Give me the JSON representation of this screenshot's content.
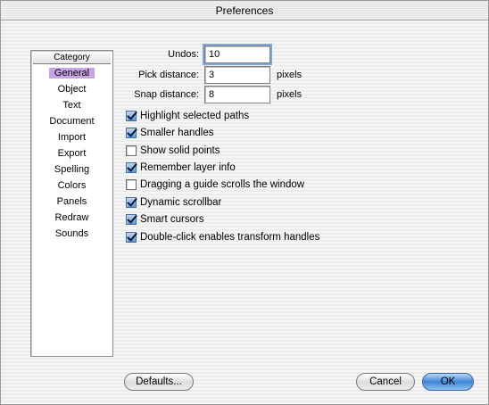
{
  "window": {
    "title": "Preferences"
  },
  "category": {
    "header": "Category",
    "items": [
      "General",
      "Object",
      "Text",
      "Document",
      "Import",
      "Export",
      "Spelling",
      "Colors",
      "Panels",
      "Redraw",
      "Sounds"
    ],
    "selected": "General"
  },
  "fields": {
    "undos": {
      "label": "Undos:",
      "value": "10"
    },
    "pick_distance": {
      "label": "Pick distance:",
      "value": "3",
      "unit": "pixels"
    },
    "snap_distance": {
      "label": "Snap distance:",
      "value": "8",
      "unit": "pixels"
    }
  },
  "options": [
    {
      "label": "Highlight selected paths",
      "checked": true
    },
    {
      "label": "Smaller handles",
      "checked": true
    },
    {
      "label": "Show solid points",
      "checked": false
    },
    {
      "label": "Remember layer info",
      "checked": true
    },
    {
      "label": "Dragging a guide scrolls the window",
      "checked": false
    },
    {
      "label": "Dynamic scrollbar",
      "checked": true
    },
    {
      "label": "Smart cursors",
      "checked": true
    },
    {
      "label": "Double-click enables transform handles",
      "checked": true
    }
  ],
  "buttons": {
    "defaults": "Defaults...",
    "cancel": "Cancel",
    "ok": "OK"
  },
  "colors": {
    "selection": "#c9a4e4",
    "default_button": "#3f86d8",
    "checkbox_checked": "#5d96d6"
  }
}
